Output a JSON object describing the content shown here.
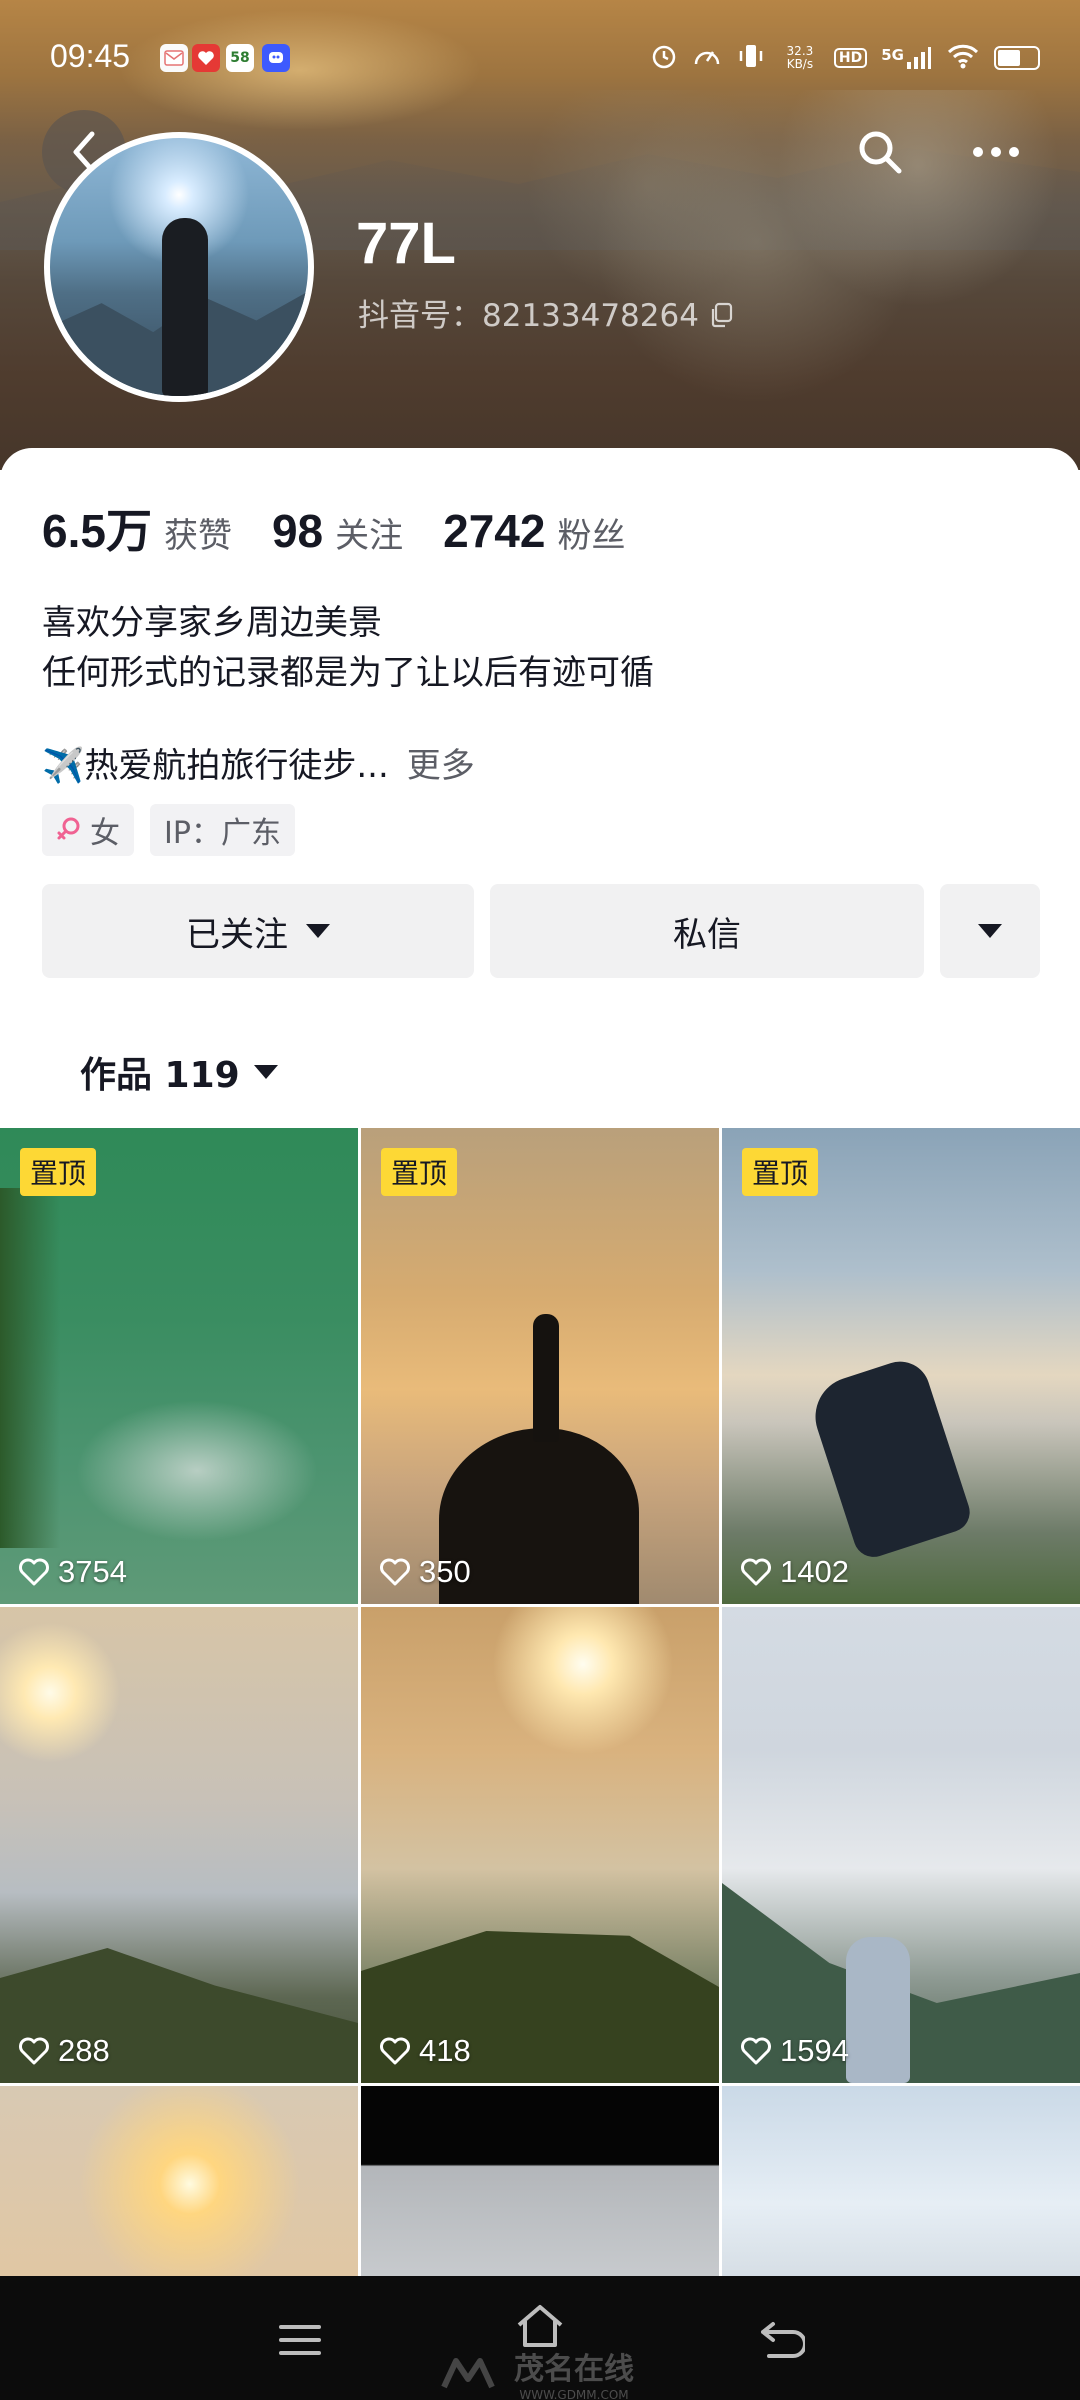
{
  "status_bar": {
    "time": "09:45",
    "network_speed": "32.3 KB/s",
    "hd": "HD",
    "signal": "5G",
    "app_icons": [
      {
        "name": "mail-app-icon",
        "color": "#ffffff"
      },
      {
        "name": "red-app-icon",
        "color": "#e53935"
      },
      {
        "name": "58-app-icon",
        "label": "58",
        "color": "#4caf50"
      },
      {
        "name": "blue-app-icon",
        "color": "#3d5afe"
      }
    ]
  },
  "profile": {
    "name": "77L",
    "douyin_id": "抖音号：82133478264",
    "stats": [
      {
        "num": "6.5万",
        "label": "获赞"
      },
      {
        "num": "98",
        "label": "关注"
      },
      {
        "num": "2742",
        "label": "粉丝"
      }
    ],
    "bio_line1": "喜欢分享家乡周边美景",
    "bio_line2": "任何形式的记录都是为了让以后有迹可循",
    "bio_line3": "✈️热爱航拍旅行徒步...",
    "more": "更多",
    "tags": {
      "gender": "女",
      "ip": "IP：广东"
    }
  },
  "actions": {
    "follow": "已关注",
    "message": "私信"
  },
  "works_tab": {
    "label": "作品 119"
  },
  "videos": [
    {
      "pinned": "置顶",
      "likes": "3754"
    },
    {
      "pinned": "置顶",
      "likes": "350"
    },
    {
      "pinned": "置顶",
      "likes": "1402"
    },
    {
      "pinned": "",
      "likes": "288"
    },
    {
      "pinned": "",
      "likes": "418"
    },
    {
      "pinned": "",
      "likes": "1594"
    },
    {
      "pinned": "",
      "likes": ""
    },
    {
      "pinned": "",
      "likes": ""
    },
    {
      "pinned": "",
      "likes": ""
    }
  ],
  "watermark": {
    "text": "茂名在线",
    "sub": "WWW.GDMM.COM"
  },
  "colors": {
    "pin_badge": "#fdd835",
    "text_primary": "#161823",
    "text_secondary": "#5c5e66",
    "gender_female": "#f06292"
  }
}
